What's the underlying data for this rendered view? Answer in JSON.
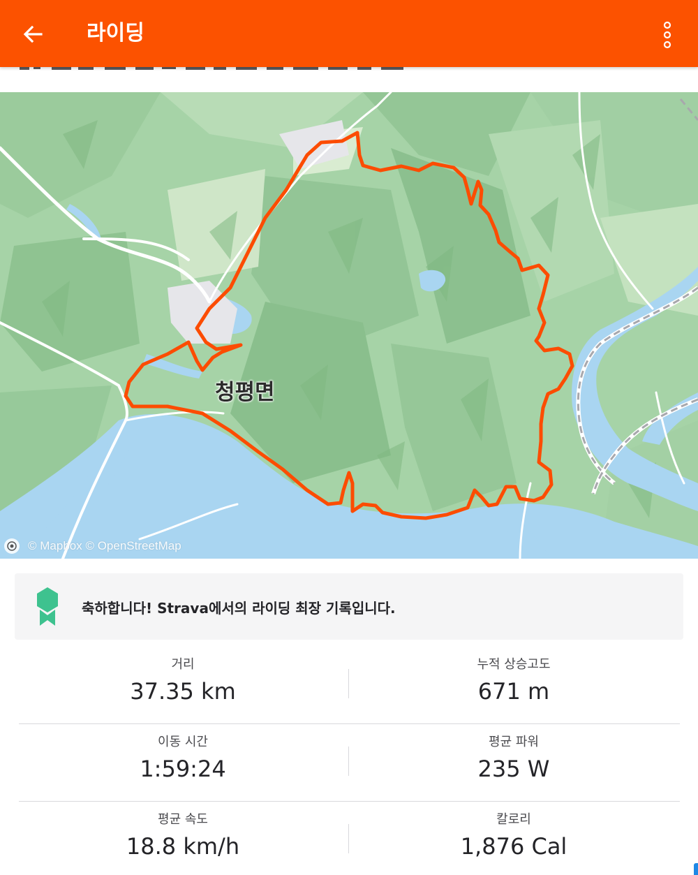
{
  "appbar": {
    "title": "라이딩",
    "back_icon": "arrow-left-icon",
    "menu_icon": "more-vertical-icon",
    "color": "#fc5200"
  },
  "map": {
    "place_label": "청평면",
    "credit": "© Mapbox © OpenStreetMap",
    "route_color": "#fc4c02",
    "water_color": "#a9d5f1",
    "land_color": "#a6d3a7"
  },
  "achievement": {
    "icon": "award-badge-icon",
    "prefix": "축하합니다!",
    "brand": "Strava",
    "suffix": "에서의 라이딩 최장 기록입니다.",
    "icon_color": "#3ec28f"
  },
  "stats": [
    {
      "left": {
        "label": "거리",
        "value": "37.35 km"
      },
      "right": {
        "label": "누적 상승고도",
        "value": "671 m"
      }
    },
    {
      "left": {
        "label": "이동 시간",
        "value": "1:59:24"
      },
      "right": {
        "label": "평균 파워",
        "value": "235 W"
      }
    },
    {
      "left": {
        "label": "평균 속도",
        "value": "18.8 km/h"
      },
      "right": {
        "label": "칼로리",
        "value": "1,876 Cal"
      }
    }
  ]
}
